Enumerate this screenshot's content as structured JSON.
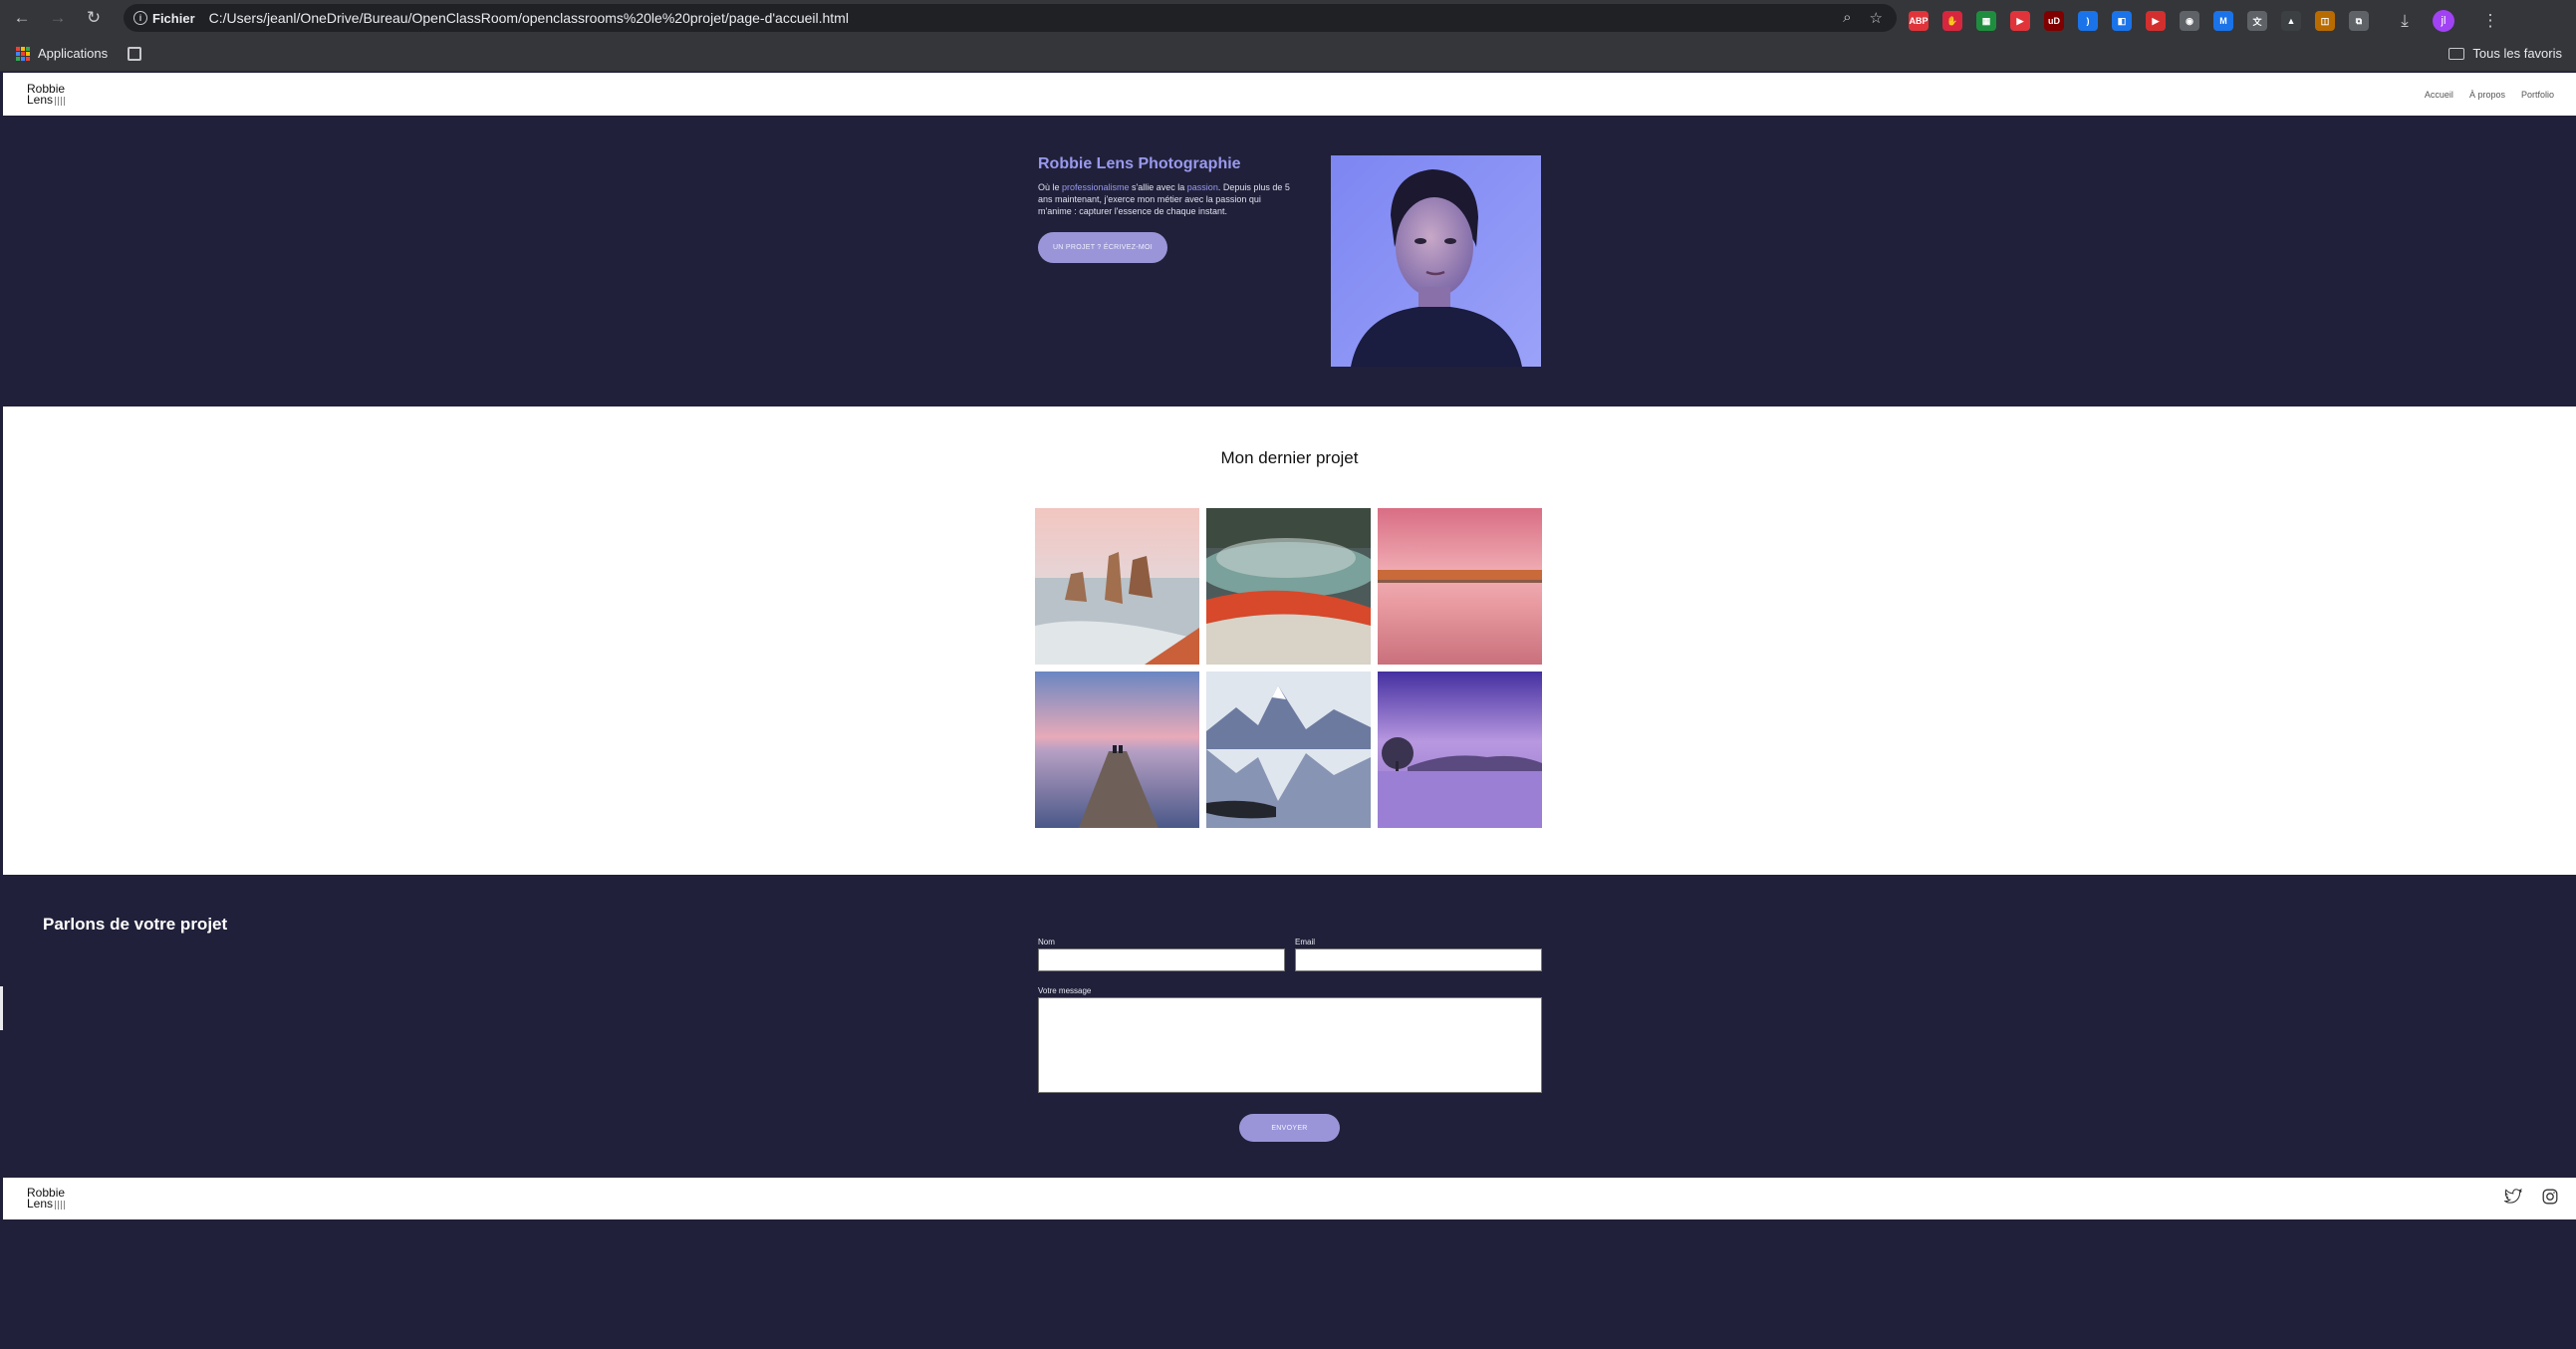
{
  "browser": {
    "site_chip": "Fichier",
    "url": "C:/Users/jeanl/OneDrive/Bureau/OpenClassRoom/openclassrooms%20le%20projet/page-d'accueil.html",
    "bookmarks_apps": "Applications",
    "bookmarks_all": "Tous les favoris",
    "profile_initial": "jl",
    "extensions": [
      {
        "label": "ABP",
        "color": "#e0343a"
      },
      {
        "label": "✋",
        "color": "#d7263d"
      },
      {
        "label": "▦",
        "color": "#1e8e3e"
      },
      {
        "label": "▶",
        "color": "#e0343a"
      },
      {
        "label": "uD",
        "color": "#800000"
      },
      {
        "label": ")",
        "color": "#1a73e8"
      },
      {
        "label": "◧",
        "color": "#1a73e8"
      },
      {
        "label": "▶",
        "color": "#d32f2f"
      },
      {
        "label": "◉",
        "color": "#5f6368"
      },
      {
        "label": "M",
        "color": "#1a73e8"
      },
      {
        "label": "文",
        "color": "#5f6368"
      },
      {
        "label": "▲",
        "color": "#3c4043"
      },
      {
        "label": "◫",
        "color": "#b86b00"
      },
      {
        "label": "⧉",
        "color": "#5f6368"
      }
    ]
  },
  "site": {
    "logo_line1": "Robbie",
    "logo_line2": "Lens",
    "nav": [
      "Accueil",
      "À propos",
      "Portfolio"
    ]
  },
  "hero": {
    "title": "Robbie Lens Photographie",
    "text_1": "Où le ",
    "text_hl1": "professionalisme",
    "text_2": " s'allie avec la ",
    "text_hl2": "passion",
    "text_3": ". Depuis plus de 5 ans maintenant, j'exerce mon métier avec la passion qui m'anime : capturer l'essence de chaque instant.",
    "cta": "UN PROJET ? ÉCRIVEZ-MOI"
  },
  "projet": {
    "title": "Mon dernier projet",
    "photos": [
      "rock-stacks-sea",
      "geothermal-pool",
      "pink-beach",
      "jetty-sunset",
      "mountain-reflection",
      "purple-lake-tree"
    ]
  },
  "contact": {
    "title": "Parlons de votre projet",
    "name_label": "Nom",
    "email_label": "Email",
    "message_label": "Votre message",
    "send": "ENVOYER"
  },
  "colors": {
    "navy": "#20203a",
    "accent": "#9999ee",
    "button": "#9a95d8"
  }
}
